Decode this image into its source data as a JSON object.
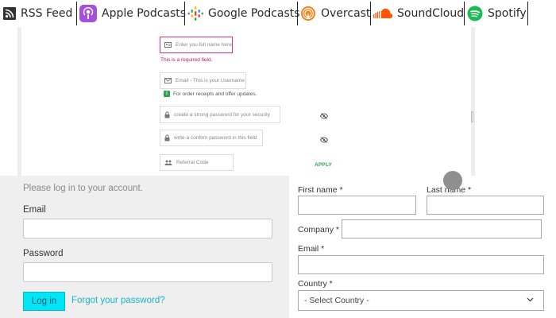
{
  "podcast_links": [
    {
      "label": "RSS Feed",
      "icon": "rss-icon"
    },
    {
      "label": "Apple Podcasts",
      "icon": "apple-podcasts-icon"
    },
    {
      "label": "Google Podcasts",
      "icon": "google-podcasts-icon"
    },
    {
      "label": "Overcast",
      "icon": "overcast-icon"
    },
    {
      "label": "SoundCloud",
      "icon": "soundcloud-icon"
    },
    {
      "label": "Spotify",
      "icon": "spotify-icon"
    }
  ],
  "register": {
    "fullname_placeholder": "Enter you full name here",
    "fullname_error": "This is a required field.",
    "email_placeholder": "Email - This is your Username",
    "email_hint": "For order receipts and offer updates.",
    "password_placeholder": "create a strong password for your security",
    "confirm_placeholder": "write a confirm password in this field",
    "referral_placeholder": "Referral Code",
    "apply_label": "APPLY"
  },
  "login": {
    "prompt": "Please log in to your account.",
    "email_label": "Email",
    "email_value": "",
    "password_label": "Password",
    "password_value": "",
    "submit_label": "Log in",
    "forgot_label": "Forgot your password?"
  },
  "shipping": {
    "first_name_label": "First name *",
    "last_name_label": "Last name *",
    "company_label": "Company *",
    "email_label": "Email *",
    "country_label": "Country *",
    "country_selected": "- Select Country -"
  },
  "colors": {
    "login_button": "#00e5f7",
    "link": "#17b6c9",
    "error": "#c2185b",
    "apply": "#2ea44f",
    "login_panel_bg": "#efefef"
  }
}
